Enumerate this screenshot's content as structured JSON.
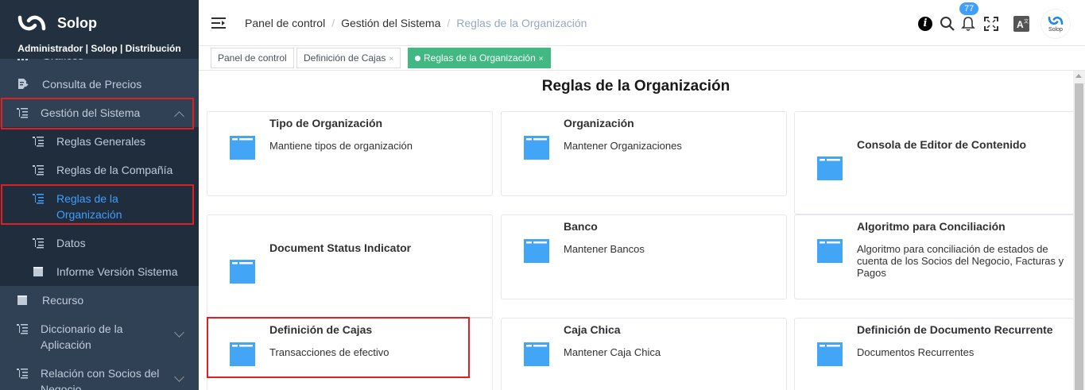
{
  "brand": {
    "name": "Solop",
    "user": "Administrador | Solop | Distribución"
  },
  "sidebar": {
    "items": [
      {
        "label": "Gráficos",
        "icon": "chart-icon"
      },
      {
        "label": "Consulta de Precios",
        "icon": "document-edit-icon"
      },
      {
        "label": "Gestión del Sistema",
        "icon": "tree-list-icon"
      },
      {
        "label": "Reglas Generales",
        "icon": "tree-list-icon"
      },
      {
        "label": "Reglas de la Compañía",
        "icon": "tree-list-icon"
      },
      {
        "label": "Reglas de la Organización",
        "line1": "Reglas de la",
        "line2": "Organización",
        "icon": "tree-list-icon"
      },
      {
        "label": "Datos",
        "icon": "tree-list-icon"
      },
      {
        "label": "Informe Versión Sistema",
        "icon": "report-icon"
      },
      {
        "label": "Recurso",
        "icon": "report-icon"
      },
      {
        "label": "Diccionario de la Aplicación",
        "line1": "Diccionario de la",
        "line2": "Aplicación",
        "icon": "tree-list-icon"
      },
      {
        "label": "Relación con Socios del Negocio",
        "line1": "Relación con Socios del",
        "line2": "Negocio",
        "icon": "tree-list-icon"
      }
    ]
  },
  "breadcrumb": [
    "Panel de control",
    "Gestión del Sistema",
    "Reglas de la Organización"
  ],
  "breadcrumb_separator": "/",
  "notifications": {
    "count": "77"
  },
  "avatar_text": "Solop",
  "tags": [
    {
      "label": "Panel de control",
      "closable": false
    },
    {
      "label": "Definición de Cajas",
      "closable": true
    },
    {
      "label": "Reglas de la Organización",
      "closable": true,
      "active": true
    }
  ],
  "tag_close": "×",
  "page": {
    "title": "Reglas de la Organización"
  },
  "cards": [
    {
      "title": "Tipo de Organización",
      "description": "Mantiene tipos de organización"
    },
    {
      "title": "Organización",
      "description": "Mantener Organizaciones"
    },
    {
      "title": "Consola de Editor de Contenido",
      "description": ""
    },
    {
      "title": "Document Status Indicator",
      "description": ""
    },
    {
      "title": "Banco",
      "description": "Mantener Bancos"
    },
    {
      "title": "Algoritmo para Conciliación",
      "description": "Algoritmo para conciliación de estados de cuenta de los Socios del Negocio, Facturas y Pagos"
    },
    {
      "title": "Definición de Cajas",
      "description": "Transacciones de efectivo"
    },
    {
      "title": "Caja Chica",
      "description": "Mantener Caja Chica"
    },
    {
      "title": "Definición de Documento Recurrente",
      "description": "Documentos Recurrentes"
    }
  ],
  "colors": {
    "sidebar_bg": "#304156",
    "sidebar_submenu_bg": "#1f2d3d",
    "active_menu": "#409eff",
    "active_tag": "#42b983",
    "folder": "#42a5f5",
    "highlight": "#e02020"
  }
}
